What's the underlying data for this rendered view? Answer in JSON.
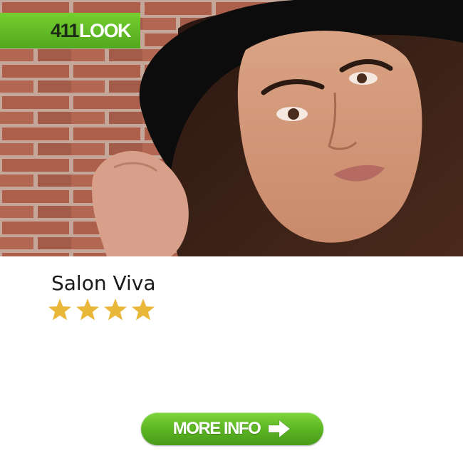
{
  "badge": {
    "number": "411",
    "word": "LOOK"
  },
  "listing": {
    "name": "Salon Viva",
    "rating": 4
  },
  "cta": {
    "label": "MORE INFO",
    "icon": "arrow-right-icon"
  },
  "colors": {
    "accent_green": "#5cb623",
    "star_gold": "#e9b73a",
    "text_dark": "#1a1a1a"
  }
}
